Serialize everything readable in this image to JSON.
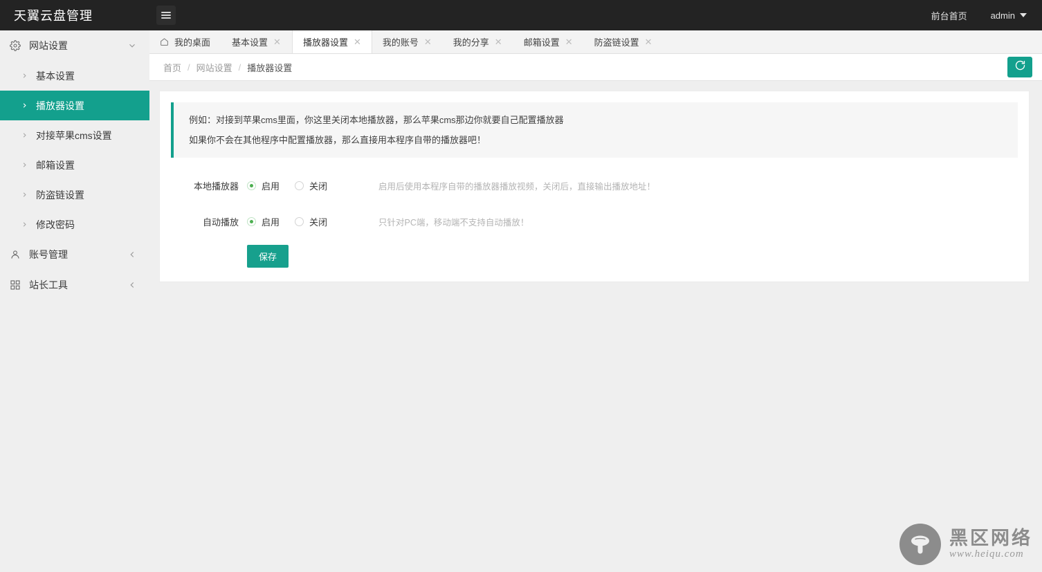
{
  "header": {
    "brand": "天翼云盘管理",
    "menu_toggle_icon": "hamburger-icon",
    "front_page_link": "前台首页",
    "user_name": "admin",
    "user_caret_icon": "chevron-down-icon"
  },
  "sidebar": {
    "groups": [
      {
        "label": "网站设置",
        "icon": "gear-icon",
        "arrow_icon": "chevron-down-icon",
        "expanded": true,
        "items": [
          {
            "label": "基本设置",
            "icon": "chevron-right-icon",
            "active": false
          },
          {
            "label": "播放器设置",
            "icon": "chevron-right-icon",
            "active": true
          },
          {
            "label": "对接苹果cms设置",
            "icon": "chevron-right-icon",
            "active": false
          },
          {
            "label": "邮箱设置",
            "icon": "chevron-right-icon",
            "active": false
          },
          {
            "label": "防盗链设置",
            "icon": "chevron-right-icon",
            "active": false
          },
          {
            "label": "修改密码",
            "icon": "chevron-right-icon",
            "active": false
          }
        ]
      },
      {
        "label": "账号管理",
        "icon": "user-icon",
        "arrow_icon": "chevron-left-icon",
        "expanded": false,
        "items": []
      },
      {
        "label": "站长工具",
        "icon": "grid-icon",
        "arrow_icon": "chevron-left-icon",
        "expanded": false,
        "items": []
      }
    ]
  },
  "tabs": [
    {
      "label": "我的桌面",
      "icon": "home-icon",
      "closable": false,
      "active": false
    },
    {
      "label": "基本设置",
      "icon": "",
      "closable": true,
      "active": false,
      "close_icon": "close-icon"
    },
    {
      "label": "播放器设置",
      "icon": "",
      "closable": true,
      "active": true,
      "close_icon": "close-icon"
    },
    {
      "label": "我的账号",
      "icon": "",
      "closable": true,
      "active": false,
      "close_icon": "close-icon"
    },
    {
      "label": "我的分享",
      "icon": "",
      "closable": true,
      "active": false,
      "close_icon": "close-icon"
    },
    {
      "label": "邮箱设置",
      "icon": "",
      "closable": true,
      "active": false,
      "close_icon": "close-icon"
    },
    {
      "label": "防盗链设置",
      "icon": "",
      "closable": true,
      "active": false,
      "close_icon": "close-icon"
    }
  ],
  "breadcrumb": {
    "items": [
      "首页",
      "网站设置",
      "播放器设置"
    ],
    "separator": "/",
    "refresh_icon": "refresh-icon"
  },
  "content": {
    "alert_lines": [
      "例如：对接到苹果cms里面，你这里关闭本地播放器，那么苹果cms那边你就要自己配置播放器",
      "如果你不会在其他程序中配置播放器，那么直接用本程序自带的播放器吧！"
    ],
    "fields": [
      {
        "label": "本地播放器",
        "options": [
          {
            "label": "启用",
            "checked": true
          },
          {
            "label": "关闭",
            "checked": false
          }
        ],
        "help": "启用后使用本程序自带的播放器播放视频，关闭后，直接输出播放地址！"
      },
      {
        "label": "自动播放",
        "options": [
          {
            "label": "启用",
            "checked": true
          },
          {
            "label": "关闭",
            "checked": false
          }
        ],
        "help": "只针对PC端，移动端不支持自动播放！"
      }
    ],
    "save_label": "保存"
  },
  "watermark": {
    "logo_icon": "mushroom-logo-icon",
    "name_cn": "黑区网络",
    "url": "www.heiqu.com"
  },
  "colors": {
    "accent": "#13A08D",
    "header_bg": "#232323",
    "page_bg": "#efefef",
    "radio_dot": "#4caf50"
  }
}
